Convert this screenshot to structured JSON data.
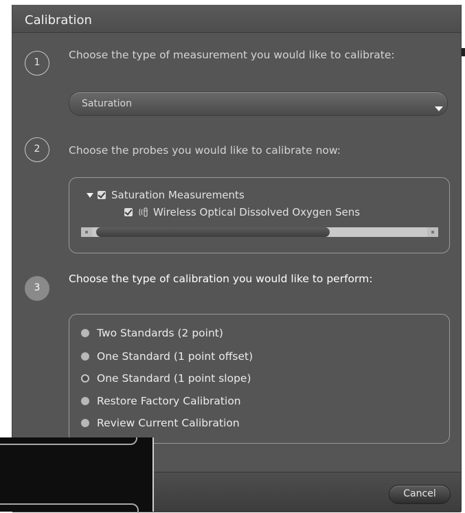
{
  "window": {
    "title": "Calibration"
  },
  "steps": [
    {
      "number": "1",
      "text": "Choose the type of measurement you would like to calibrate:"
    },
    {
      "number": "2",
      "text": "Choose the probes you would like to calibrate now:"
    },
    {
      "number": "3",
      "text": "Choose the type of calibration you would like to perform:"
    }
  ],
  "measurement_select": {
    "value": "Saturation"
  },
  "probes_tree": {
    "group_label": "Saturation Measurements",
    "group_checked": true,
    "probe_label": "Wireless Optical Dissolved Oxygen Sens",
    "probe_checked": true
  },
  "calibration_options": [
    {
      "label": "Two Standards (2 point)",
      "selected": false
    },
    {
      "label": "One Standard (1 point offset)",
      "selected": false
    },
    {
      "label": "One Standard (1 point slope)",
      "selected": true
    },
    {
      "label": "Restore Factory Calibration",
      "selected": false
    },
    {
      "label": "Review Current Calibration",
      "selected": false
    }
  ],
  "footer": {
    "cancel_label": "Cancel"
  },
  "colors": {
    "dialog_bg": "#555555",
    "panel_border": "#9a9a9a",
    "active_step": "#8a8a8a"
  }
}
